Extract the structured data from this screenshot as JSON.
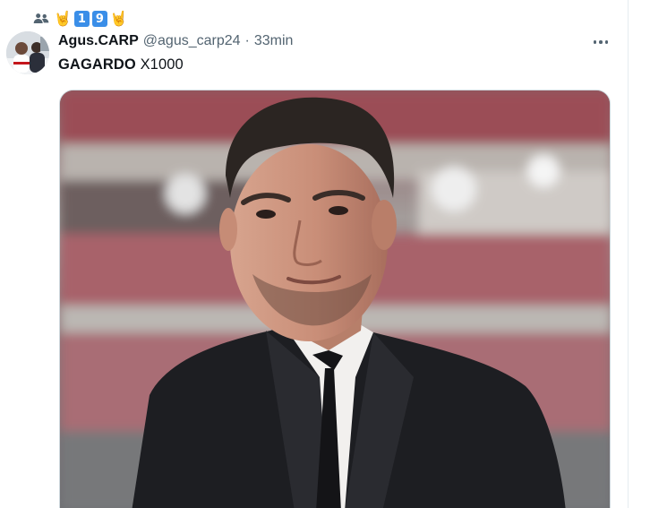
{
  "context": {
    "icon": "people-icon",
    "label_parts": [
      "🤘",
      "1",
      "9",
      "🤘"
    ]
  },
  "tweet": {
    "display_name": "Agus.CARP",
    "handle": "@agus_carp24",
    "separator": "·",
    "time": "33min",
    "text_bold": "GAGARDO",
    "text_rest": "X1000"
  },
  "icons": {
    "more": "more-horizontal-icon",
    "context": "people-icon"
  },
  "media": {
    "description_icon": "photo"
  },
  "colors": {
    "name": "#0f1419",
    "secondary": "#536471",
    "keycap": "#3a8ee8",
    "divider": "#e6ecf0"
  }
}
